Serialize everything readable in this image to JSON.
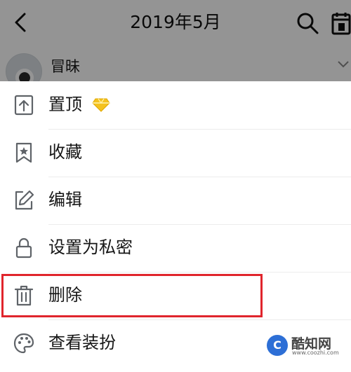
{
  "header": {
    "title": "2019年5月"
  },
  "post": {
    "username": "冒昧"
  },
  "menu": {
    "items": [
      {
        "label": "置顶"
      },
      {
        "label": "收藏"
      },
      {
        "label": "编辑"
      },
      {
        "label": "设置为私密"
      },
      {
        "label": "删除"
      },
      {
        "label": "查看装扮"
      }
    ]
  },
  "watermark": {
    "name": "酷知网",
    "url": "www.coozhi.com",
    "logo": "C"
  },
  "colors": {
    "highlight": "#e0252c",
    "gem": "#f4c21f",
    "icon": "#5f6368"
  }
}
